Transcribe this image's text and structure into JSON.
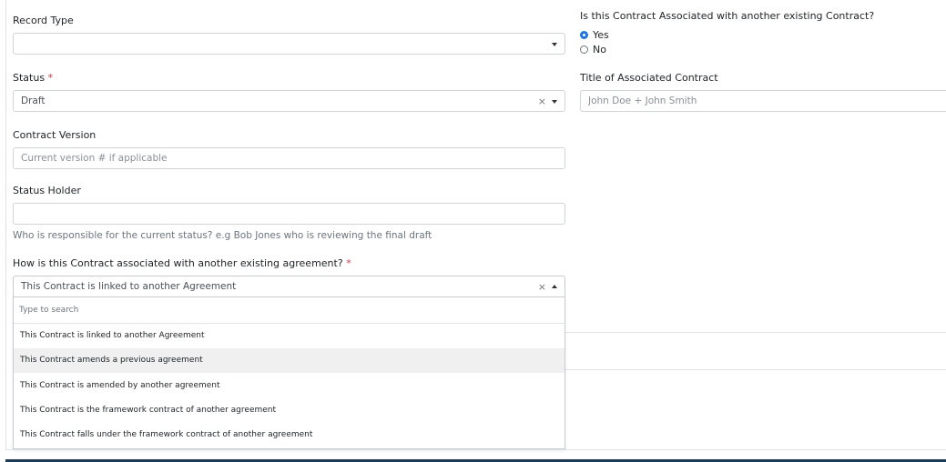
{
  "form": {
    "record_type": {
      "label": "Record Type",
      "value": ""
    },
    "status": {
      "label": "Status",
      "required_mark": "*",
      "value": "Draft",
      "clear_glyph": "×"
    },
    "contract_version": {
      "label": "Contract Version",
      "placeholder": "Current version # if applicable",
      "value": ""
    },
    "status_holder": {
      "label": "Status Holder",
      "value": "",
      "help": "Who is responsible for the current status? e.g Bob Jones who is reviewing the final draft"
    },
    "association_type": {
      "label": "How is this Contract associated with another existing agreement?",
      "required_mark": "*",
      "value": "This Contract is linked to another Agreement",
      "clear_glyph": "×",
      "search_placeholder": "Type to search",
      "options": [
        "This Contract is linked to another Agreement",
        "This Contract amends a previous agreement",
        "This Contract is amended by another agreement",
        "This Contract is the framework contract of another agreement",
        "This Contract falls under the framework contract of another agreement"
      ],
      "hovered_option_index": 1
    },
    "associated_question": {
      "label": "Is this Contract Associated with another existing Contract?",
      "options": [
        "Yes",
        "No"
      ],
      "selected": "Yes"
    },
    "associated_title": {
      "label": "Title of Associated Contract",
      "placeholder": "John Doe + John Smith",
      "value": ""
    }
  },
  "colors": {
    "accent": "#1a73e8",
    "required": "#dc3545",
    "border": "#ced4da",
    "hover_bg": "#f0f0f0",
    "bottom_bar": "#1c3d5a"
  }
}
